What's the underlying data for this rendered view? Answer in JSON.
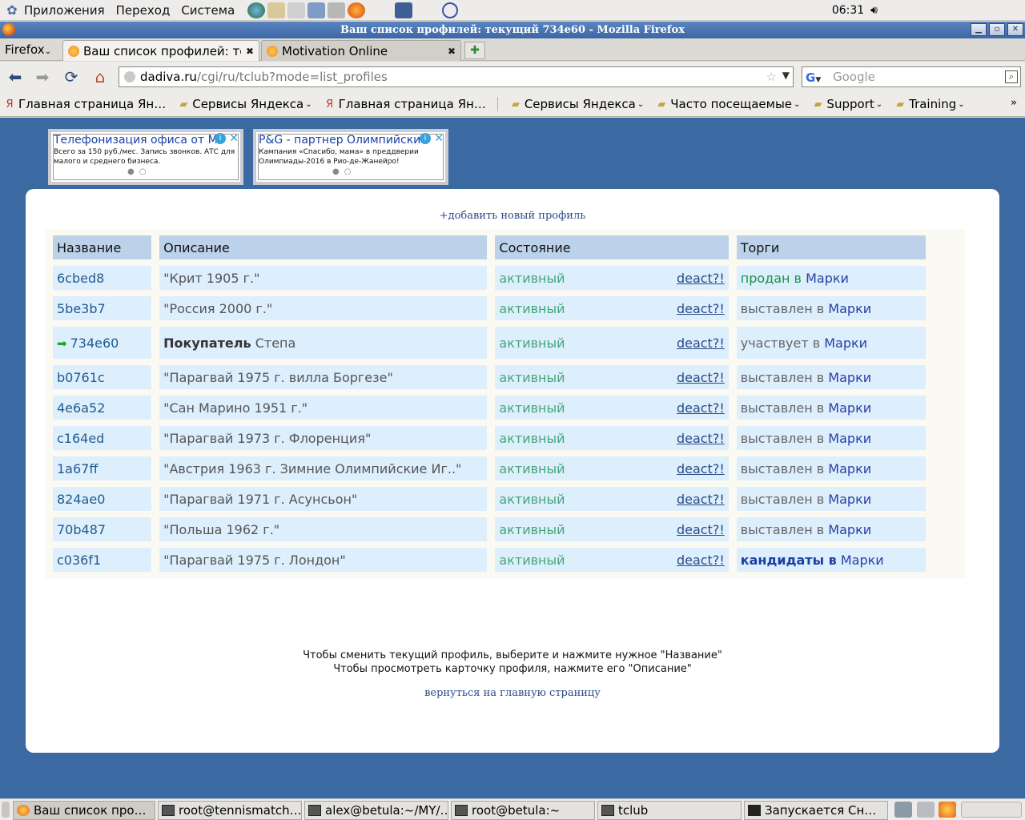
{
  "top_panel": {
    "menus": [
      "Приложения",
      "Переход",
      "Система"
    ],
    "clock": "06:31"
  },
  "window": {
    "title": "Ваш список профилей: текущий 734e60 - Mozilla Firefox"
  },
  "browser": {
    "firefox_menu": "Firefox",
    "tabs": [
      {
        "label": "Ваш список профилей: те…",
        "active": true
      },
      {
        "label": "Motivation Online",
        "active": false
      }
    ],
    "url_domain": "dadiva.ru",
    "url_path": "/cgi/ru/tclub?mode=list_profiles",
    "search_placeholder": "Google",
    "bookmarks": [
      {
        "label": "Главная страница Ян…",
        "icon": "yandex-icon",
        "folder": false
      },
      {
        "label": "Сервисы Яндекса",
        "icon": "folder-icon",
        "folder": true
      },
      {
        "label": "Главная страница Ян…",
        "icon": "yandex-icon",
        "folder": false
      },
      {
        "label": "Сервисы Яндекса",
        "icon": "folder-icon",
        "folder": true
      },
      {
        "label": "Часто посещаемые",
        "icon": "folder-icon",
        "folder": true
      },
      {
        "label": "Support",
        "icon": "folder-icon",
        "folder": true
      },
      {
        "label": "Training",
        "icon": "folder-icon",
        "folder": true
      }
    ],
    "bookmarks_more": "»"
  },
  "ads": [
    {
      "title": "Телефонизация офиса от МТС",
      "text": "Всего за 150 руб./мес. Запись звонков. АТС для малого и среднего бизнеса."
    },
    {
      "title": "P&G - партнер Олимпийских игр",
      "text": "Кампания «Спасибо, мама» в преддверии Олимпиады-2016 в Рио-де-Жанейро!"
    }
  ],
  "page": {
    "add_profile": "+добавить новый профиль",
    "headers": {
      "name": "Название",
      "description": "Описание",
      "state": "Состояние",
      "trade": "Торги"
    },
    "deact_label": "deact?!",
    "market_label": "Марки",
    "rows": [
      {
        "name": "6cbed8",
        "desc": "\"Крит 1905 г.\"",
        "state": "активный",
        "trade_status": "продан в",
        "trade_kind": "sold",
        "current": false
      },
      {
        "name": "5be3b7",
        "desc": "\"Россия 2000 г.\"",
        "state": "активный",
        "trade_status": "выставлен в",
        "trade_kind": "listed",
        "current": false
      },
      {
        "name": "734e60",
        "desc_bold": "Покупатель",
        "desc": "Степа",
        "state": "активный",
        "trade_status": "участвует в",
        "trade_kind": "listed",
        "current": true
      },
      {
        "name": "b0761c",
        "desc": "\"Парагвай 1975 г. вилла Боргезе\"",
        "state": "активный",
        "trade_status": "выставлен в",
        "trade_kind": "listed",
        "current": false
      },
      {
        "name": "4e6a52",
        "desc": "\"Сан Марино 1951 г.\"",
        "state": "активный",
        "trade_status": "выставлен в",
        "trade_kind": "listed",
        "current": false
      },
      {
        "name": "c164ed",
        "desc": "\"Парагвай 1973 г. Флоренция\"",
        "state": "активный",
        "trade_status": "выставлен в",
        "trade_kind": "listed",
        "current": false
      },
      {
        "name": "1a67ff",
        "desc": "\"Австрия 1963 г. Зимние Олимпийские Иг..\"",
        "state": "активный",
        "trade_status": "выставлен в",
        "trade_kind": "listed",
        "current": false
      },
      {
        "name": "824ae0",
        "desc": "\"Парагвай 1971 г. Асунсьон\"",
        "state": "активный",
        "trade_status": "выставлен в",
        "trade_kind": "listed",
        "current": false
      },
      {
        "name": "70b487",
        "desc": "\"Польша 1962 г.\"",
        "state": "активный",
        "trade_status": "выставлен в",
        "trade_kind": "listed",
        "current": false
      },
      {
        "name": "c036f1",
        "desc": "\"Парагвай 1975 г. Лондон\"",
        "state": "активный",
        "trade_status": "кандидаты в",
        "trade_kind": "candidates",
        "current": false
      }
    ],
    "hint1": "Чтобы сменить текущий профиль, выберите и нажмите нужное \"Название\"",
    "hint2": "Чтобы просмотреть карточку профиля, нажмите его \"Описание\"",
    "back_link": "вернуться на главную страницу"
  },
  "taskbar": {
    "tasks": [
      {
        "label": "Ваш список про…",
        "icon": "firefox-icon",
        "active": true
      },
      {
        "label": "root@tennismatch…",
        "icon": "terminal-icon",
        "active": false
      },
      {
        "label": "alex@betula:~/MY/…",
        "icon": "terminal-icon",
        "active": false
      },
      {
        "label": "root@betula:~",
        "icon": "terminal-icon",
        "active": false
      },
      {
        "label": "tclub",
        "icon": "terminal-icon",
        "active": false
      },
      {
        "label": "Запускается Сн…",
        "icon": "camera-icon",
        "active": false
      }
    ]
  },
  "colors": {
    "page_bg": "#3a6aa1",
    "header_cell": "#bcd2ea",
    "data_cell": "#ddeefd",
    "active_state": "#46a679",
    "link": "#2a4b88"
  }
}
